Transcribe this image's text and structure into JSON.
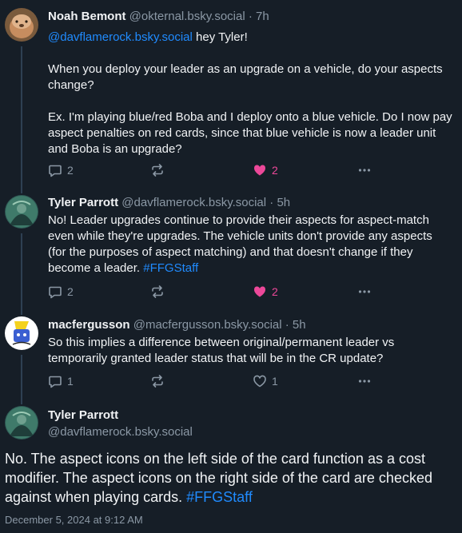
{
  "posts": [
    {
      "author_name": "Noah Bemont",
      "author_handle": "@okternal.bsky.social",
      "time": "7h",
      "mention": "@davflamerock.bsky.social",
      "line1_rest": " hey Tyler!",
      "para2": "When you deploy your leader as an upgrade on a vehicle, do your aspects change?",
      "para3": "Ex. I'm playing blue/red Boba and I deploy onto a blue vehicle. Do I now pay aspect penalties on red cards, since that blue vehicle is now a leader unit and Boba is an upgrade?",
      "reply_count": "2",
      "like_count": "2"
    },
    {
      "author_name": "Tyler Parrott",
      "author_handle": "@davflamerock.bsky.social",
      "time": "5h",
      "text": "No! Leader upgrades continue to provide their aspects for aspect-match even while they're upgrades. The vehicle units don't provide any aspects (for the purposes of aspect matching) and that doesn't change if they become a leader.",
      "hashtag": "#FFGStaff",
      "reply_count": "2",
      "like_count": "2"
    },
    {
      "author_name": "macfergusson",
      "author_handle": "@macfergusson.bsky.social",
      "time": "5h",
      "text": "So this implies a difference between original/permanent leader vs temporarily granted leader status that will be in the CR update?",
      "reply_count": "1",
      "like_count": "1"
    }
  ],
  "focus": {
    "author_name": "Tyler Parrott",
    "author_handle": "@davflamerock.bsky.social",
    "text": "No. The aspect icons on the left side of the card function as a cost modifier. The aspect icons on the right side of the card are checked against when playing cards.",
    "hashtag": "#FFGStaff",
    "date": "December 5, 2024 at 9:12 AM"
  },
  "ui": {
    "separator": " · ",
    "icons": [
      "reply-icon",
      "repost-icon",
      "heart-icon",
      "more-icon"
    ],
    "colors": {
      "background": "#161e27",
      "link": "#208bfe",
      "like": "#ec4899",
      "muted": "#8b98a5"
    }
  }
}
